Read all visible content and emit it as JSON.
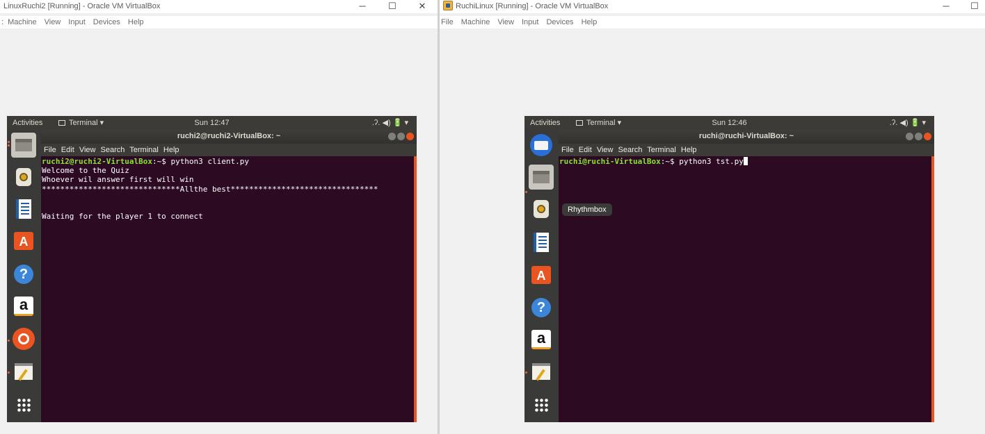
{
  "left_window": {
    "title": "LinuxRuchi2 [Running] - Oracle VM VirtualBox",
    "controls": {
      "minimize": "─",
      "maximize": "☐",
      "close": "✕"
    },
    "menu": [
      "Machine",
      "View",
      "Input",
      "Devices",
      "Help"
    ],
    "guest": {
      "topbar": {
        "activities": "Activities",
        "app": "Terminal ▾",
        "clock": "Sun 12:47",
        "sys_icons": ".ʔ.  ◀)  🔋 ▾"
      },
      "terminal": {
        "title": "ruchi2@ruchi2-VirtualBox: ~",
        "menu": [
          "File",
          "Edit",
          "View",
          "Search",
          "Terminal",
          "Help"
        ],
        "prompt": "ruchi2@ruchi2-VirtualBox",
        "prompt_suffix": ":~$ python3 client.py",
        "output": "Welcome to the Quiz\nWhoever wil answer first will win\n******************************Allthe best********************************\n\n\nWaiting for the player 1 to connect"
      },
      "dock_icons": [
        "files-icon",
        "rhythmbox-icon",
        "writer-icon",
        "software-center-icon",
        "help-icon",
        "amazon-icon",
        "ubuntu-icon",
        "text-editor-icon",
        "app-grid-icon"
      ]
    }
  },
  "right_window": {
    "title": "RuchiLinux [Running] - Oracle VM VirtualBox",
    "controls": {
      "minimize": "─",
      "maximize": "☐"
    },
    "menu": [
      "File",
      "Machine",
      "View",
      "Input",
      "Devices",
      "Help"
    ],
    "guest": {
      "topbar": {
        "activities": "Activities",
        "app": "Terminal ▾",
        "clock": "Sun 12:46",
        "sys_icons": ".ʔ.  ◀)  🔋 ▾"
      },
      "terminal": {
        "title": "ruchi@ruchi-VirtualBox: ~",
        "menu": [
          "File",
          "Edit",
          "View",
          "Search",
          "Terminal",
          "Help"
        ],
        "prompt": "ruchi@ruchi-VirtualBox",
        "prompt_suffix": ":~$ python3 tst.py"
      },
      "tooltip": "Rhythmbox",
      "dock_icons": [
        "thunderbird-icon",
        "files-icon",
        "rhythmbox-icon",
        "writer-icon",
        "software-center-icon",
        "help-icon",
        "amazon-icon",
        "text-editor-icon",
        "app-grid-icon"
      ]
    }
  },
  "colors": {
    "accent": "#e95420",
    "terminal_bg": "#2c0a22",
    "prompt_green": "#8ae234",
    "panel": "#3c3b37"
  }
}
